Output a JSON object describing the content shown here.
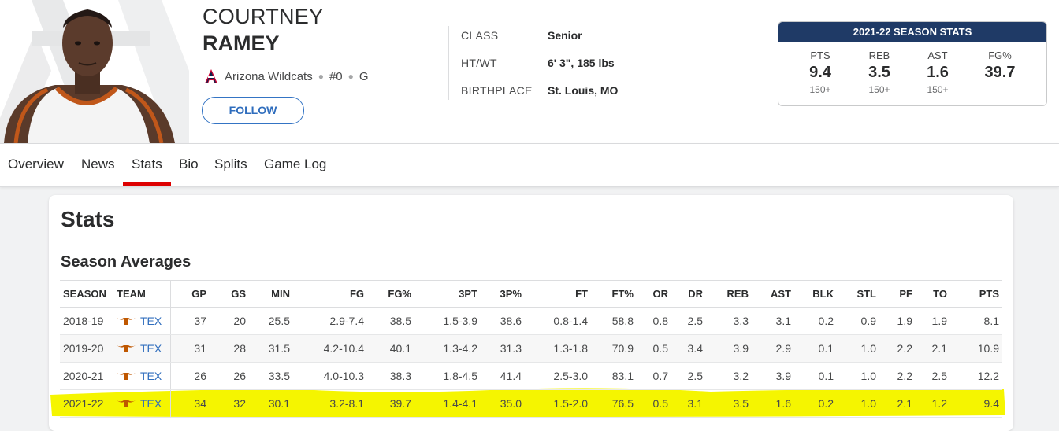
{
  "player": {
    "first_name": "COURTNEY",
    "last_name": "RAMEY",
    "team": "Arizona Wildcats",
    "number": "#0",
    "position": "G",
    "follow_label": "FOLLOW"
  },
  "bio": [
    {
      "label": "CLASS",
      "value": "Senior"
    },
    {
      "label": "HT/WT",
      "value": "6' 3\", 185 lbs"
    },
    {
      "label": "BIRTHPLACE",
      "value": "St. Louis, MO"
    }
  ],
  "season_box": {
    "title": "2021-22 SEASON STATS",
    "stats": [
      {
        "label": "PTS",
        "value": "9.4",
        "rank": "150+"
      },
      {
        "label": "REB",
        "value": "3.5",
        "rank": "150+"
      },
      {
        "label": "AST",
        "value": "1.6",
        "rank": "150+"
      },
      {
        "label": "FG%",
        "value": "39.7",
        "rank": ""
      }
    ]
  },
  "nav": {
    "items": [
      "Overview",
      "News",
      "Stats",
      "Bio",
      "Splits",
      "Game Log"
    ],
    "active": "Stats"
  },
  "stats_section": {
    "title": "Stats",
    "subtitle": "Season Averages",
    "headers": [
      "SEASON",
      "TEAM",
      "GP",
      "GS",
      "MIN",
      "FG",
      "FG%",
      "3PT",
      "3P%",
      "FT",
      "FT%",
      "OR",
      "DR",
      "REB",
      "AST",
      "BLK",
      "STL",
      "PF",
      "TO",
      "PTS"
    ],
    "rows": [
      [
        "2018-19",
        "TEX",
        "37",
        "20",
        "25.5",
        "2.9-7.4",
        "38.5",
        "1.5-3.9",
        "38.6",
        "0.8-1.4",
        "58.8",
        "0.8",
        "2.5",
        "3.3",
        "3.1",
        "0.2",
        "0.9",
        "1.9",
        "1.9",
        "8.1"
      ],
      [
        "2019-20",
        "TEX",
        "31",
        "28",
        "31.5",
        "4.2-10.4",
        "40.1",
        "1.3-4.2",
        "31.3",
        "1.3-1.8",
        "70.9",
        "0.5",
        "3.4",
        "3.9",
        "2.9",
        "0.1",
        "1.0",
        "2.2",
        "2.1",
        "10.9"
      ],
      [
        "2020-21",
        "TEX",
        "26",
        "26",
        "33.5",
        "4.0-10.3",
        "38.3",
        "1.8-4.5",
        "41.4",
        "2.5-3.0",
        "83.1",
        "0.7",
        "2.5",
        "3.2",
        "3.9",
        "0.1",
        "1.0",
        "2.2",
        "2.5",
        "12.2"
      ],
      [
        "2021-22",
        "TEX",
        "34",
        "32",
        "30.1",
        "3.2-8.1",
        "39.7",
        "1.4-4.1",
        "35.0",
        "1.5-2.0",
        "76.5",
        "0.5",
        "3.1",
        "3.5",
        "1.6",
        "0.2",
        "1.0",
        "2.1",
        "1.2",
        "9.4"
      ]
    ],
    "highlighted_row": "2021-22"
  },
  "colors": {
    "highlight": "#f5f500",
    "navy": "#1f3a66",
    "link": "#2f6dbd",
    "active_tab": "#dd0000",
    "longhorn": "#bf5700"
  },
  "icons": {
    "team_logo": "arizona-logo-icon",
    "row_team_logo": "longhorn-icon"
  }
}
